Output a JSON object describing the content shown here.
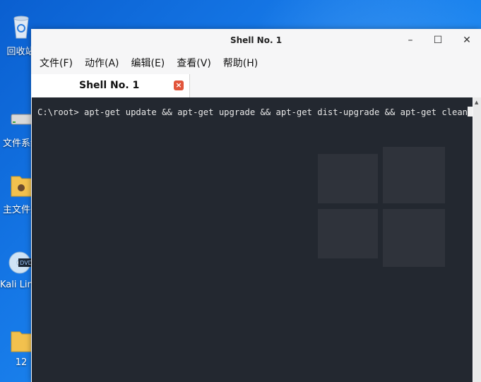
{
  "desktop": {
    "icons": [
      {
        "label": "回收站",
        "icon": "recycle-bin-icon"
      },
      {
        "label": "文件系统",
        "icon": "drive-icon"
      },
      {
        "label": "主文件夹",
        "icon": "home-folder-icon"
      },
      {
        "label": "Kali Linux",
        "icon": "kali-dvd-icon"
      },
      {
        "label": "12",
        "icon": "folder-icon"
      }
    ]
  },
  "window": {
    "title": "Shell No. 1",
    "controls": {
      "minimize": "–",
      "maximize": "☐",
      "close": "✕"
    }
  },
  "menu": {
    "items": [
      "文件(F)",
      "动作(A)",
      "编辑(E)",
      "查看(V)",
      "帮助(H)"
    ]
  },
  "tabs": [
    {
      "label": "Shell No. 1",
      "close": "×"
    }
  ],
  "terminal": {
    "prompt": "C:\\root>",
    "command": " apt-get update && apt-get upgrade && apt-get dist-upgrade && apt-get clean"
  },
  "colors": {
    "desktop": "#1577e6",
    "terminal_bg": "#232830",
    "tab_close": "#e2553b"
  }
}
